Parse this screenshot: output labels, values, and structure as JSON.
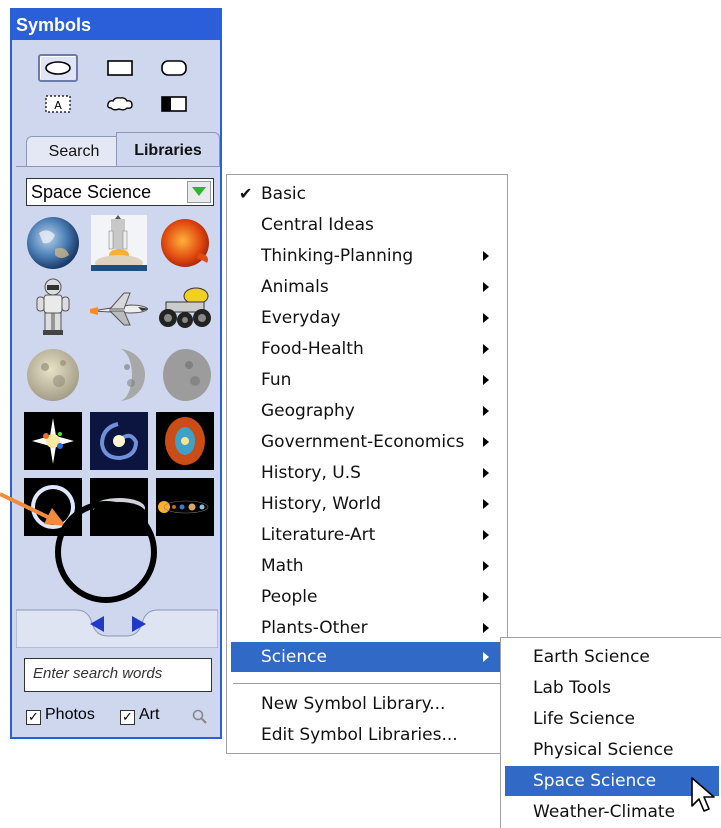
{
  "palette": {
    "title": "Symbols",
    "tabs": {
      "search": "Search",
      "libraries": "Libraries"
    },
    "library_selected": "Space Science",
    "search_placeholder": "Enter search words",
    "filters": {
      "photos": {
        "label": "Photos",
        "checked": true
      },
      "art": {
        "label": "Art",
        "checked": true
      }
    },
    "shapes": [
      "oval-shape",
      "rectangle-shape",
      "rounded-rectangle-shape",
      "text-box-shape",
      "cloud-shape",
      "half-filled-rectangle-shape"
    ],
    "thumbnails": [
      "earth",
      "space-shuttle-launch",
      "sun",
      "astronaut",
      "space-shuttle",
      "lunar-rover",
      "full-moon",
      "half-moon",
      "gibbous-moon",
      "supernova",
      "spiral-galaxy",
      "nebula",
      "solar-eclipse",
      "earthrise",
      "solar-system"
    ]
  },
  "main_menu": {
    "items": [
      {
        "label": "Basic",
        "checked": true,
        "submenu": false
      },
      {
        "label": "Central Ideas",
        "submenu": false
      },
      {
        "label": "Thinking-Planning",
        "submenu": true
      },
      {
        "label": "Animals",
        "submenu": true
      },
      {
        "label": "Everyday",
        "submenu": true
      },
      {
        "label": "Food-Health",
        "submenu": true
      },
      {
        "label": "Fun",
        "submenu": true
      },
      {
        "label": "Geography",
        "submenu": true
      },
      {
        "label": "Government-Economics",
        "submenu": true
      },
      {
        "label": "History, U.S",
        "submenu": true
      },
      {
        "label": "History, World",
        "submenu": true
      },
      {
        "label": "Literature-Art",
        "submenu": true
      },
      {
        "label": "Math",
        "submenu": true
      },
      {
        "label": "People",
        "submenu": true
      },
      {
        "label": "Plants-Other",
        "submenu": true
      },
      {
        "label": "Science",
        "submenu": true,
        "active": true
      }
    ],
    "actions": [
      {
        "label": "New Symbol Library..."
      },
      {
        "label": "Edit Symbol Libraries..."
      }
    ]
  },
  "sub_menu": {
    "items": [
      {
        "label": "Earth Science"
      },
      {
        "label": "Lab Tools"
      },
      {
        "label": "Life Science"
      },
      {
        "label": "Physical Science"
      },
      {
        "label": "Space Science",
        "active": true
      },
      {
        "label": "Weather-Climate"
      }
    ]
  },
  "colors": {
    "accent": "#2b5fd9",
    "menu_highlight": "#3169c6",
    "palette_bg": "#cfd7ef",
    "annotation_arrow": "#f08a3c"
  }
}
